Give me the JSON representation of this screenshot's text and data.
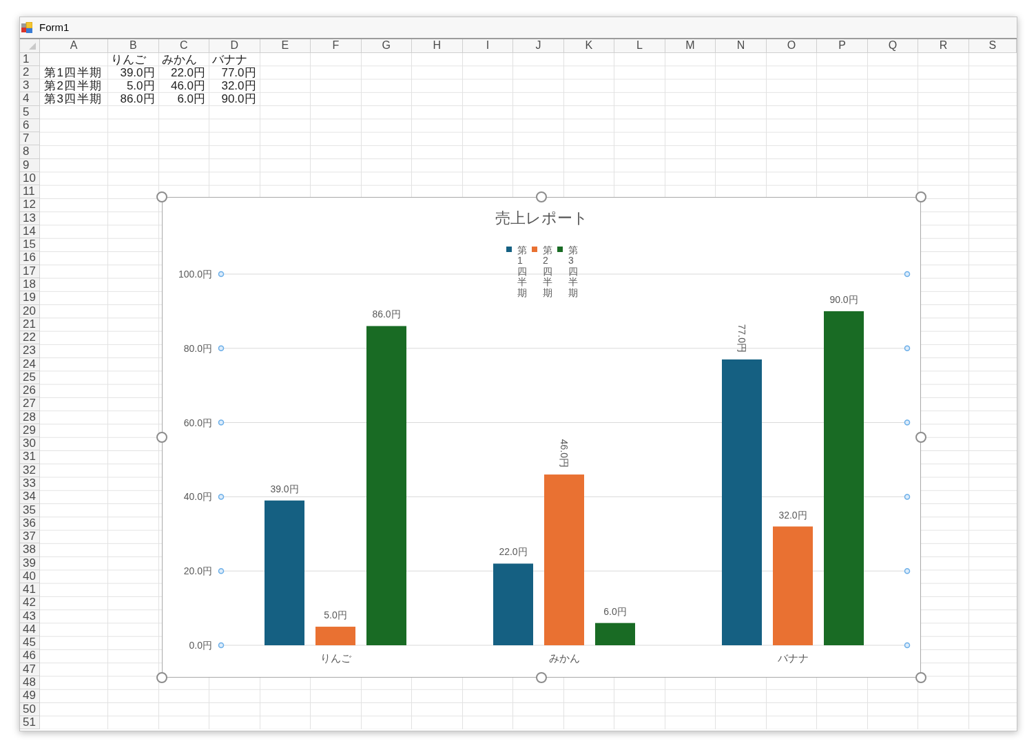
{
  "window": {
    "title": "Form1"
  },
  "sheet": {
    "columns": [
      "A",
      "B",
      "C",
      "D",
      "E",
      "F",
      "G",
      "H",
      "I",
      "J",
      "K",
      "L",
      "M",
      "N",
      "O",
      "P",
      "Q",
      "R",
      "S"
    ],
    "rows": [
      {
        "number": "1",
        "cells": [
          "",
          "りんご",
          "みかん",
          "バナナ"
        ]
      },
      {
        "number": "2",
        "cells": [
          "第1四半期",
          "39.0円",
          "22.0円",
          "77.0円"
        ]
      },
      {
        "number": "3",
        "cells": [
          "第2四半期",
          "5.0円",
          "46.0円",
          "32.0円"
        ]
      },
      {
        "number": "4",
        "cells": [
          "第3四半期",
          "86.0円",
          "6.0円",
          "90.0円"
        ]
      },
      {
        "number": "5"
      },
      {
        "number": "6"
      },
      {
        "number": "7"
      },
      {
        "number": "8"
      },
      {
        "number": "9"
      },
      {
        "number": "10"
      },
      {
        "number": "11"
      },
      {
        "number": "12"
      },
      {
        "number": "13"
      },
      {
        "number": "14"
      },
      {
        "number": "15"
      },
      {
        "number": "16"
      },
      {
        "number": "17"
      },
      {
        "number": "18"
      },
      {
        "number": "19"
      },
      {
        "number": "20"
      },
      {
        "number": "21"
      },
      {
        "number": "22"
      },
      {
        "number": "23"
      },
      {
        "number": "24"
      },
      {
        "number": "25"
      },
      {
        "number": "26"
      },
      {
        "number": "27"
      },
      {
        "number": "28"
      },
      {
        "number": "29"
      },
      {
        "number": "30"
      },
      {
        "number": "31"
      },
      {
        "number": "32"
      },
      {
        "number": "33"
      },
      {
        "number": "34"
      },
      {
        "number": "35"
      },
      {
        "number": "36"
      },
      {
        "number": "37"
      },
      {
        "number": "38"
      },
      {
        "number": "39"
      },
      {
        "number": "40"
      },
      {
        "number": "41"
      },
      {
        "number": "42"
      },
      {
        "number": "43"
      },
      {
        "number": "44"
      },
      {
        "number": "45"
      },
      {
        "number": "46"
      },
      {
        "number": "47"
      },
      {
        "number": "48"
      },
      {
        "number": "49"
      },
      {
        "number": "50"
      },
      {
        "number": "51"
      }
    ]
  },
  "chart": {
    "selected": true,
    "chart_data": {
      "type": "bar",
      "title": "売上レポート",
      "legend": true,
      "grid": true,
      "categories": [
        "りんご",
        "みかん",
        "バナナ"
      ],
      "series": [
        {
          "name": "第1四半期",
          "color": "#156082",
          "values": [
            39,
            22,
            77
          ]
        },
        {
          "name": "第2四半期",
          "color": "#e97132",
          "values": [
            5,
            46,
            32
          ]
        },
        {
          "name": "第3四半期",
          "color": "#196b24",
          "values": [
            86,
            6,
            90
          ]
        }
      ],
      "ylim": [
        0,
        100
      ],
      "yticks": [
        {
          "value": 100,
          "label": "100.0円"
        },
        {
          "value": 80,
          "label": "80.0円"
        },
        {
          "value": 60,
          "label": "60.0円"
        },
        {
          "value": 40,
          "label": "40.0円"
        },
        {
          "value": 20,
          "label": "20.0円"
        },
        {
          "value": 0,
          "label": "0.0円"
        }
      ],
      "value_labels": [
        [
          {
            "text": "39.0円",
            "vertical": false
          },
          {
            "text": "22.0円",
            "vertical": false
          },
          {
            "text": "77.0円",
            "vertical": true
          }
        ],
        [
          {
            "text": "5.0円",
            "vertical": false
          },
          {
            "text": "46.0円",
            "vertical": true
          },
          {
            "text": "32.0円",
            "vertical": false
          }
        ],
        [
          {
            "text": "86.0円",
            "vertical": false
          },
          {
            "text": "6.0円",
            "vertical": false
          },
          {
            "text": "90.0円",
            "vertical": false
          }
        ]
      ]
    }
  }
}
